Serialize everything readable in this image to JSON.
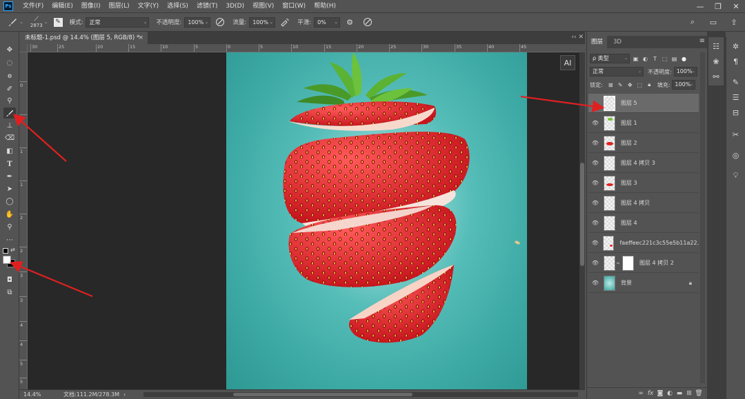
{
  "app": {
    "logo": "Ps"
  },
  "menubar": {
    "items": [
      "文件(F)",
      "编辑(E)",
      "图像(I)",
      "图层(L)",
      "文字(Y)",
      "选择(S)",
      "滤镜(T)",
      "3D(D)",
      "视图(V)",
      "窗口(W)",
      "帮助(H)"
    ]
  },
  "window_controls": {
    "minimize": "—",
    "restore": "❐",
    "close": "✕"
  },
  "options": {
    "brush_size": "2873",
    "mode_label": "模式:",
    "mode_value": "正常",
    "opacity_label": "不透明度:",
    "opacity_value": "100%",
    "flow_label": "流量:",
    "flow_value": "100%",
    "smooth_label": "平滑:",
    "smooth_value": "0%"
  },
  "document": {
    "tab_title": "未标题-1.psd @ 14.4% (图层 5, RGB/8) *",
    "close": "×",
    "zoom": "14.4%",
    "doc_info": "文档:111.2M/278.3M"
  },
  "rulers": {
    "top": [
      "30",
      "25",
      "20",
      "15",
      "10",
      "5",
      "0",
      "5",
      "10",
      "15",
      "20",
      "25",
      "30",
      "35",
      "40",
      "45"
    ],
    "left": [
      "0",
      "5",
      "1",
      "1",
      "2",
      "2",
      "3",
      "3",
      "4",
      "4",
      "5",
      "5"
    ]
  },
  "ai_badge": "AI",
  "layers_panel": {
    "tabs": [
      "图层",
      "3D"
    ],
    "kind_filter": "ρ 类型",
    "blend_mode": "正常",
    "opacity_label": "不透明度:",
    "opacity_value": "100%",
    "lock_label": "锁定:",
    "fill_label": "填充:",
    "fill_value": "100%",
    "layers": [
      {
        "name": "图层 5",
        "visible": false,
        "selected": true,
        "thumb": "blank"
      },
      {
        "name": "图层 1",
        "visible": true,
        "selected": false,
        "thumb": "leaf"
      },
      {
        "name": "图层 2",
        "visible": true,
        "selected": false,
        "thumb": "red"
      },
      {
        "name": "图层 4 拷贝 3",
        "visible": true,
        "selected": false,
        "thumb": "blank"
      },
      {
        "name": "图层 3",
        "visible": true,
        "selected": false,
        "thumb": "red"
      },
      {
        "name": "图层 4 拷贝",
        "visible": true,
        "selected": false,
        "thumb": "blank"
      },
      {
        "name": "图层 4",
        "visible": true,
        "selected": false,
        "thumb": "blank"
      },
      {
        "name": "faeffeec221c3c55e5b11a22...",
        "visible": true,
        "selected": false,
        "thumb": "small-red"
      },
      {
        "name": "图层 4 拷贝 2",
        "visible": true,
        "selected": false,
        "thumb": "masked"
      },
      {
        "name": "背景",
        "visible": true,
        "selected": false,
        "thumb": "bg",
        "locked": true
      }
    ]
  },
  "colors": {
    "ui_bg": "#535353",
    "canvas_bg": "#282828",
    "artboard_teal": "#4fb8b3",
    "arrow_red": "#e02020",
    "selected_layer": "#6a6a6a"
  }
}
